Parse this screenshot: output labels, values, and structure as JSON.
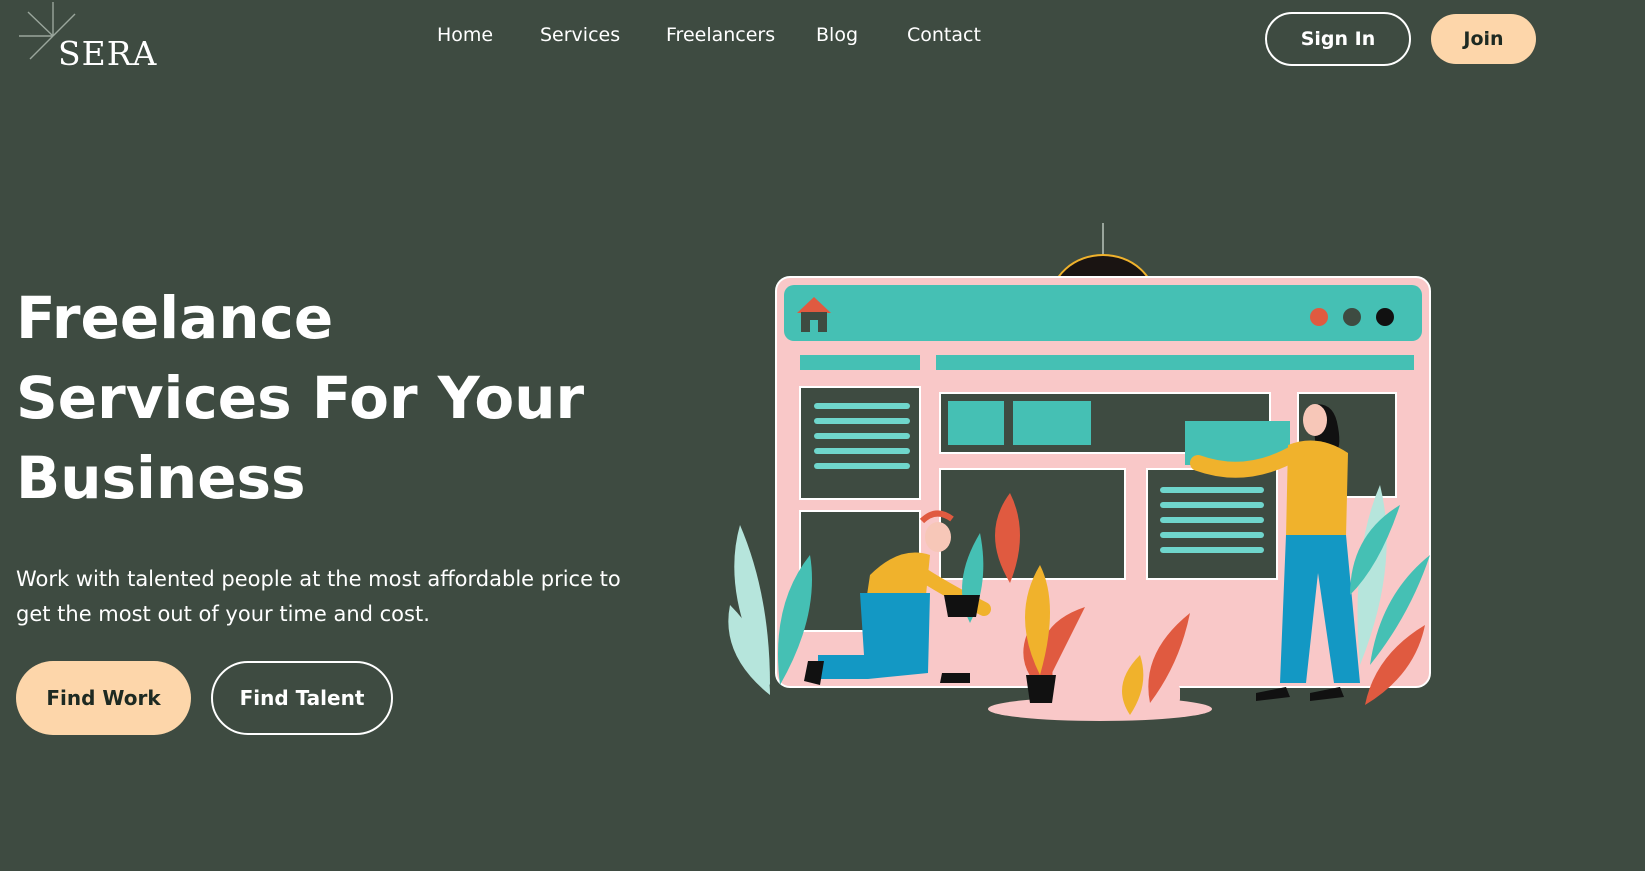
{
  "brand": {
    "name": "SERA"
  },
  "nav": {
    "links": [
      {
        "label": "Home"
      },
      {
        "label": "Services"
      },
      {
        "label": "Freelancers"
      },
      {
        "label": "Blog"
      },
      {
        "label": "Contact"
      }
    ],
    "sign_in": "Sign In",
    "join": "Join"
  },
  "hero": {
    "title_lines": [
      "Freelance",
      "Services For Your",
      "Business"
    ],
    "subtitle": "Work with talented people at the most affordable price to get the most out of your time and cost.",
    "find_work": "Find Work",
    "find_talent": "Find Talent"
  },
  "colors": {
    "background": "#3e4b41",
    "accent": "#fdd6aa",
    "teal": "#45c0b4",
    "pink": "#f9c8c8",
    "orange": "#e05a40",
    "yellow": "#f0b22c",
    "blue": "#1398c4"
  },
  "icons": [
    "sparkle-icon",
    "home-icon"
  ]
}
